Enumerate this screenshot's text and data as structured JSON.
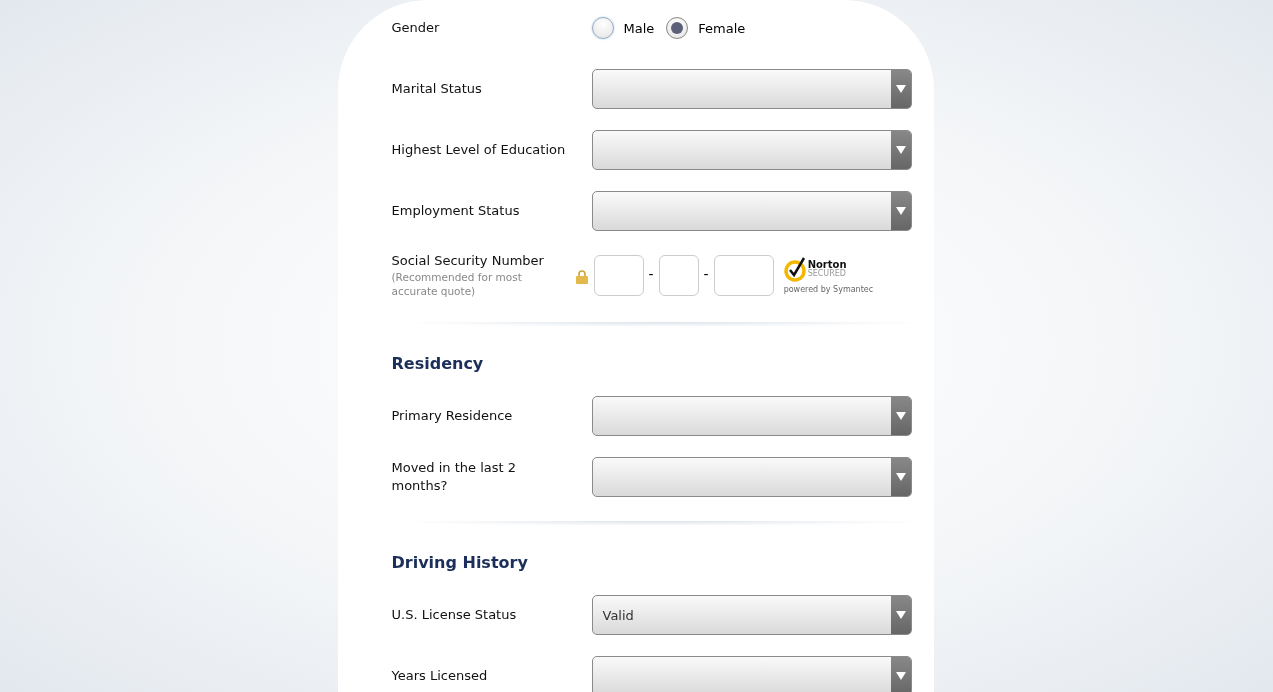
{
  "sections": [
    {
      "rows": [
        {
          "kind": "radio",
          "label": "Gender",
          "options": [
            {
              "label": "Male",
              "selected": false
            },
            {
              "label": "Female",
              "selected": true
            }
          ]
        },
        {
          "kind": "select",
          "label": "Marital Status"
        },
        {
          "kind": "select",
          "label": "Highest Level of Education"
        },
        {
          "kind": "select",
          "label": "Employment Status"
        },
        {
          "kind": "ssn",
          "label": "Social Security Number",
          "hint": "(Recommended for most accurate quote)",
          "separators": [
            "-",
            "-"
          ],
          "badge": {
            "name": "Norton",
            "tagline": "SECURED",
            "footer": "powered by Symantec"
          }
        }
      ]
    },
    {
      "title": "Residency",
      "rows": [
        {
          "kind": "select",
          "label": "Primary Residence"
        },
        {
          "kind": "select",
          "label": "Moved in the last 2 months?"
        }
      ]
    },
    {
      "title": "Driving History",
      "rows": [
        {
          "kind": "select",
          "label": "U.S. License Status",
          "value": "Valid"
        },
        {
          "kind": "select",
          "label": "Years Licensed"
        }
      ]
    }
  ]
}
